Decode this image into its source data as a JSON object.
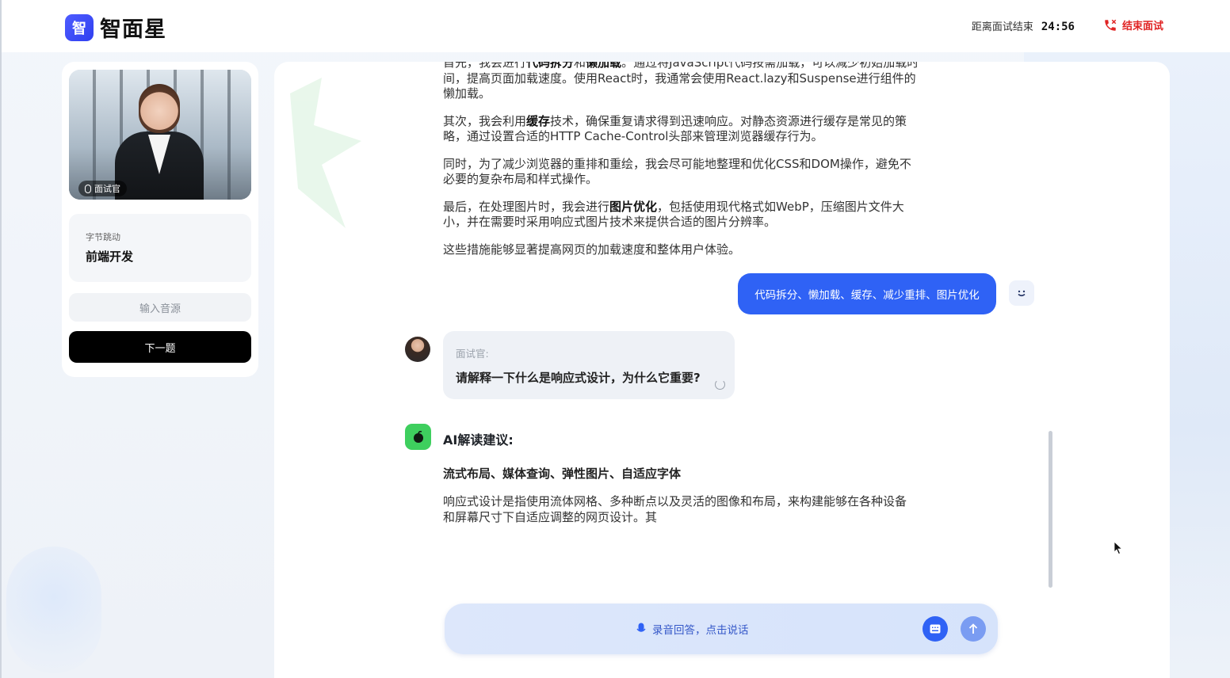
{
  "app": {
    "logo_glyph": "智",
    "name": "智面星"
  },
  "header": {
    "timer_label": "距离面试结束",
    "timer_value": "24:56",
    "end_button": "结束面试"
  },
  "sidebar": {
    "avatar_tag": "面试官",
    "company": "字节跳动",
    "position": "前端开发",
    "audio_input": "输入音源",
    "next_button": "下一题"
  },
  "chat": {
    "answer_paragraphs": [
      {
        "pre": "首先，我会进行",
        "bold": "代码拆分",
        "mid": "和",
        "bold2": "懒加载",
        "post": "。通过将JavaScript代码按需加载，可以减少初始加载时间，提高页面加载速度。使用React时，我通常会使用React.lazy和Suspense进行组件的懒加载。"
      },
      {
        "pre": "其次，我会利用",
        "bold": "缓存",
        "mid": "",
        "bold2": "",
        "post": "技术，确保重复请求得到迅速响应。对静态资源进行缓存是常见的策略，通过设置合适的HTTP Cache-Control头部来管理浏览器缓存行为。"
      },
      {
        "pre": "同时，为了减少浏览器的重排和重绘，我会尽可能地整理和优化CSS和DOM操作，避免不必要的复杂布局和样式操作。",
        "bold": "",
        "mid": "",
        "bold2": "",
        "post": ""
      },
      {
        "pre": "最后，在处理图片时，我会进行",
        "bold": "图片优化",
        "mid": "",
        "bold2": "",
        "post": "，包括使用现代格式如WebP，压缩图片文件大小，并在需要时采用响应式图片技术来提供合适的图片分辨率。"
      },
      {
        "pre": "这些措施能够显著提高网页的加载速度和整体用户体验。",
        "bold": "",
        "mid": "",
        "bold2": "",
        "post": ""
      }
    ],
    "user_message": "代码拆分、懒加载、缓存、减少重排、图片优化",
    "interviewer_role": "面试官:",
    "interviewer_question": "请解释一下什么是响应式设计，为什么它重要?",
    "ai_title": "AI解读建议:",
    "ai_keywords": "流式布局、媒体查询、弹性图片、自适应字体",
    "ai_description": "响应式设计是指使用流体网格、多种断点以及灵活的图像和布局，来构建能够在各种设备和屏幕尺寸下自适应调整的网页设计。其"
  },
  "composer": {
    "voice_hint": "录音回答，点击说话"
  },
  "colors": {
    "brand": "#2f3ff0",
    "primary_blue": "#2f62f5",
    "danger": "#e02424",
    "ai_green": "#3ecf5e"
  },
  "icons": [
    "phone-hangup-icon",
    "mic-icon",
    "keyboard-icon",
    "send-arrow-icon",
    "ai-bot-icon",
    "smile-icon",
    "loading-icon",
    "cursor-icon"
  ]
}
